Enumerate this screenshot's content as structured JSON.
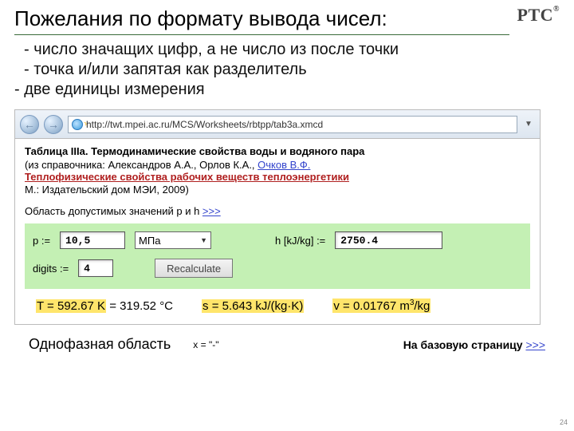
{
  "header": {
    "title": "Пожелания по формату вывода чисел:",
    "logo": "PTC"
  },
  "bullets": {
    "b1": " - число значащих цифр, а не число из после точки",
    "b2": " - точка и/или запятая как разделитель",
    "b3": "- две единицы измерения"
  },
  "addr": {
    "url": "http://twt.mpei.ac.ru/MCS/Worksheets/rbtpp/tab3a.xmcd",
    "back": "←",
    "fwd": "→",
    "dd": "▼"
  },
  "doc": {
    "t1": "Таблица IIIа. Термодинамические свойства воды и водяного пара",
    "t2a": "(из справочника: Александров А.А., Орлов К.А., ",
    "t2b": "Очков В.Ф.",
    "red": "Теплофизические свойства рабочих веществ теплоэнергетики",
    "t3": "М.: Издательский дом МЭИ, 2009)",
    "valid_lbl": "Область допустимых значений p и h ",
    "more": ">>>"
  },
  "form": {
    "p_lbl": "p :=",
    "p_val": "10,5",
    "unit_sel": "МПа",
    "h_lbl": "h [kJ/kg] :=",
    "h_val": "2750.4",
    "dig_lbl": "digits :=",
    "dig_val": "4",
    "btn": "Recalculate"
  },
  "results": {
    "T_hl": "T = 592.67 K",
    "T_c": " = 319.52 °C",
    "s": "s = 5.643 kJ/(kg·K)",
    "v_pre": "v = 0.01767 m",
    "v_exp": "3",
    "v_post": "/kg"
  },
  "footer": {
    "phase": "Однофазная область",
    "x_lbl": "x = \"-\"",
    "back_lbl": "На базовую страницу ",
    "back_link": ">>>"
  },
  "pagenum": "24"
}
